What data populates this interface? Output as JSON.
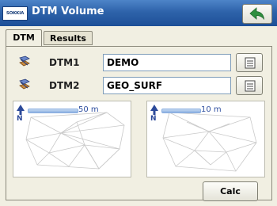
{
  "window": {
    "title": "DTM Volume",
    "logo_text": "SOKKIA"
  },
  "tabs": [
    {
      "label": "DTM"
    },
    {
      "label": "Results"
    }
  ],
  "rows": [
    {
      "label": "DTM1",
      "value": "DEMO"
    },
    {
      "label": "DTM2",
      "value": "GEO_SURF"
    }
  ],
  "previews": [
    {
      "north_label": "N",
      "scale_label": "50 m"
    },
    {
      "north_label": "N",
      "scale_label": "10 m"
    }
  ],
  "actions": {
    "calc_label": "Calc"
  },
  "icons": {
    "back": "back-arrow-icon",
    "file": "file-list-icon",
    "dtm": "dtm-surface-icon",
    "north": "north-arrow-icon"
  },
  "colors": {
    "titlebar": "#2e63aa",
    "panel": "#f1efe2",
    "back_arrow": "#2f8f3f",
    "scale": "#2f4fa0"
  }
}
